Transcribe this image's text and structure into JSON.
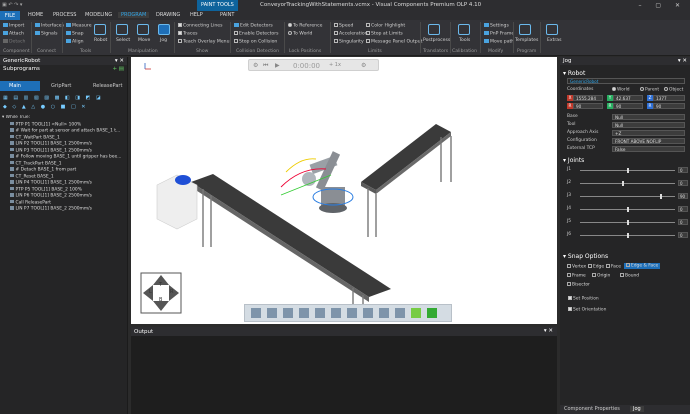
{
  "window": {
    "title": "ConveyorTrackingWithStatements.vcmx - Visual Components Premium OLP 4.10",
    "context_tab": "PAINT TOOLS"
  },
  "menu": [
    "FILE",
    "HOME",
    "PROCESS",
    "MODELING",
    "PROGRAM",
    "DRAWING",
    "HELP",
    "PAINT"
  ],
  "ribbon": {
    "component": [
      "Import",
      "Attach",
      "Detach"
    ],
    "connect": [
      "Interfaces",
      "Signals"
    ],
    "tools": [
      "Measure",
      "Snap",
      "Align"
    ],
    "robot": "Robot",
    "manipulation": [
      "Select",
      "Move",
      "Jog"
    ],
    "show": [
      "Connecting Lines",
      "Traces",
      "Teach Overlay Menu"
    ],
    "collision": [
      "Edit Detectors",
      "Enable Detectors",
      "Stop on Collision"
    ],
    "lock": [
      "To Reference",
      "To World"
    ],
    "limits": [
      "Speed",
      "Acceleration",
      "Singularity"
    ],
    "limits2": [
      "Color Highlight",
      "Stop at Limits",
      "Message Panel Output"
    ],
    "translators": "Postprocess",
    "calibration": "Tools",
    "modify": [
      "Settings",
      "PnP Frame",
      "Move path"
    ],
    "program": "Templates",
    "extras": "Extras",
    "groups": [
      "Component",
      "Connect",
      "Tools",
      "Manipulation",
      "Show",
      "Collision Detection",
      "Lock Positions",
      "Limits",
      "Translators",
      "Calibration",
      "Modify",
      "Program"
    ]
  },
  "left": {
    "panel_title": "GenericRobot",
    "subprograms_title": "Subprograms",
    "tabs": [
      "Main",
      "GripPart",
      "ReleasePart"
    ],
    "tree": [
      "While True:",
      "PTP P1 TOOL[1] <Null> 100%",
      "# Wait for part at sensor and attach BASE_1 t...",
      "CT_WaitPart BASE_1",
      "LIN P2 TOOL[1] BASE_1 2500mm/s",
      "LIN P3 TOOL[1] BASE_1 2500mm/s",
      "# Follow moving BASE_1 until gripper has bee...",
      "CT_TrackPart BASE_1",
      "# Detach BASE_1 from part",
      "CT_Reset BASE_1",
      "LIN P4 TOOL[1] BASE_1 2500mm/s",
      "PTP P5 TOOL[1] BASE_2 100%",
      "LIN P6 TOOL[1] BASE_2 2500mm/s",
      "Call ReleasePart",
      "LIN P7 TOOL[1] BASE_2 2500mm/s"
    ]
  },
  "viewport": {
    "time": "0:00:00",
    "speed": "+ 1x",
    "compass": [
      "L",
      "T",
      "R",
      "B"
    ]
  },
  "output": {
    "title": "Output"
  },
  "jog": {
    "title": "Jog",
    "robot_section": "Robot",
    "robot_name": "GenericRobot",
    "coord_label": "Coordinates",
    "coord_opts": [
      "World",
      "Parent",
      "Object"
    ],
    "x": "1555.284",
    "y": "42.637",
    "z": "1377",
    "rx": "90",
    "ry": "90",
    "rz": "90",
    "fields": [
      {
        "label": "Base",
        "value": "Null"
      },
      {
        "label": "Tool",
        "value": "Null"
      },
      {
        "label": "Approach Axis",
        "value": "+Z"
      },
      {
        "label": "Configuration",
        "value": "FRONT ABOVE NOFLIP"
      },
      {
        "label": "External TCP",
        "value": "False"
      }
    ],
    "joints_section": "Joints",
    "joints": [
      {
        "name": "J1",
        "value": "0",
        "pos": 0.5
      },
      {
        "name": "J2",
        "value": "0",
        "pos": 0.45
      },
      {
        "name": "J3",
        "value": "90",
        "pos": 0.86
      },
      {
        "name": "J4",
        "value": "0",
        "pos": 0.5
      },
      {
        "name": "J5",
        "value": "0",
        "pos": 0.5
      },
      {
        "name": "J6",
        "value": "0",
        "pos": 0.5
      }
    ],
    "snap_section": "Snap Options",
    "snap": [
      "Vertex",
      "Edge",
      "Face",
      "Edge & Face",
      "Frame",
      "Origin",
      "Bound",
      "Bisector"
    ],
    "set_position": "Set Position",
    "set_orientation": "Set Orientation"
  },
  "bottom_tabs": [
    "Component Properties",
    "Jog"
  ]
}
